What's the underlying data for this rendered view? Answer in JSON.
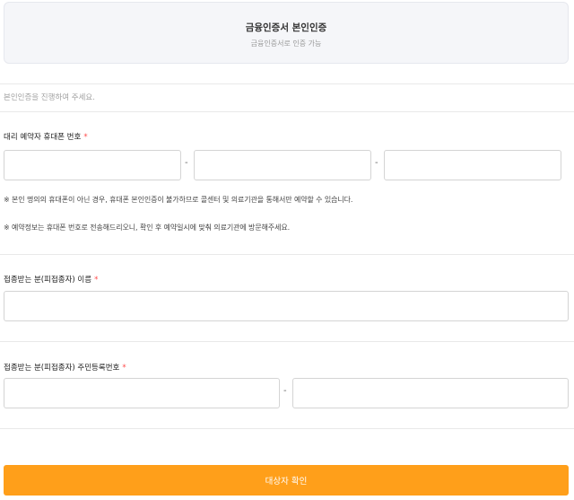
{
  "cert": {
    "title": "금융인증서 본인인증",
    "subtitle": "금융인증서로 인증 가능"
  },
  "intro_text": "본인인증을 진행하여 주세요.",
  "phone": {
    "label": "대리 예약자 휴대폰 번호",
    "required_mark": "*",
    "separator": "-",
    "part1_value": "",
    "part2_value": "",
    "part3_value": ""
  },
  "notes": [
    "※ 본인 명의의 휴대폰이 아닌 경우, 휴대폰 본인인증이 불가하므로 콜센터 및 의료기관을 통해서만 예약할 수 있습니다.",
    "※ 예약정보는 휴대폰 번호로 전송해드리오니, 확인 후 예약일시에 맞춰 의료기관에 방문해주세요."
  ],
  "name": {
    "label": "접종받는 분(피접종자) 이름",
    "required_mark": "*",
    "value": ""
  },
  "rrn": {
    "label": "접종받는 분(피접종자) 주민등록번호",
    "required_mark": "*",
    "separator": "-",
    "front_value": "",
    "back_value": ""
  },
  "submit_label": "대상자 확인",
  "colors": {
    "accent": "#ff9f1a",
    "required": "#ff4a4a",
    "card_bg": "#f5f6f9"
  }
}
